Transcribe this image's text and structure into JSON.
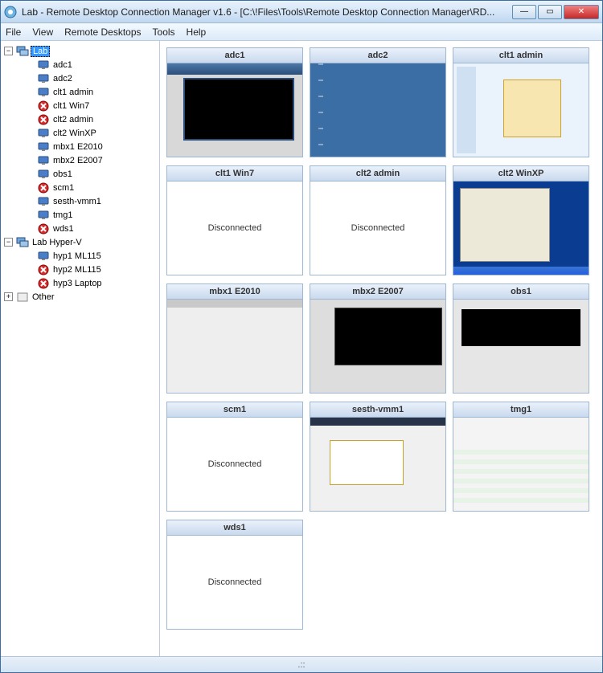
{
  "window": {
    "title": "Lab - Remote Desktop Connection Manager v1.6 - [C:\\!Files\\Tools\\Remote Desktop Connection Manager\\RD..."
  },
  "menu": {
    "file": "File",
    "view": "View",
    "remote": "Remote Desktops",
    "tools": "Tools",
    "help": "Help"
  },
  "tree": {
    "lab": {
      "label": "Lab",
      "expanded": true,
      "selected": true
    },
    "lab_items": [
      {
        "label": "adc1",
        "status": "ok"
      },
      {
        "label": "adc2",
        "status": "ok"
      },
      {
        "label": "clt1 admin",
        "status": "ok"
      },
      {
        "label": "clt1 Win7",
        "status": "err"
      },
      {
        "label": "clt2 admin",
        "status": "err"
      },
      {
        "label": "clt2 WinXP",
        "status": "ok"
      },
      {
        "label": "mbx1 E2010",
        "status": "ok"
      },
      {
        "label": "mbx2 E2007",
        "status": "ok"
      },
      {
        "label": "obs1",
        "status": "ok"
      },
      {
        "label": "scm1",
        "status": "err"
      },
      {
        "label": "sesth-vmm1",
        "status": "ok"
      },
      {
        "label": "tmg1",
        "status": "ok"
      },
      {
        "label": "wds1",
        "status": "err"
      }
    ],
    "hyperv": {
      "label": "Lab Hyper-V",
      "expanded": true
    },
    "hyperv_items": [
      {
        "label": "hyp1 ML115",
        "status": "ok"
      },
      {
        "label": "hyp2 ML115",
        "status": "err"
      },
      {
        "label": "hyp3 Laptop",
        "status": "err"
      }
    ],
    "other": {
      "label": "Other",
      "expanded": false
    }
  },
  "thumbnails": [
    {
      "title": "adc1",
      "state": "connected",
      "view": "adc1"
    },
    {
      "title": "adc2",
      "state": "connected",
      "view": "adc2"
    },
    {
      "title": "clt1 admin",
      "state": "connected",
      "view": "clt1admin"
    },
    {
      "title": "clt1 Win7",
      "state": "disconnected"
    },
    {
      "title": "clt2 admin",
      "state": "disconnected"
    },
    {
      "title": "clt2 WinXP",
      "state": "connected",
      "view": "clt2winxp"
    },
    {
      "title": "mbx1 E2010",
      "state": "connected",
      "view": "mbx1"
    },
    {
      "title": "mbx2 E2007",
      "state": "connected",
      "view": "mbx2"
    },
    {
      "title": "obs1",
      "state": "connected",
      "view": "obs1"
    },
    {
      "title": "scm1",
      "state": "disconnected"
    },
    {
      "title": "sesth-vmm1",
      "state": "connected",
      "view": "sesth"
    },
    {
      "title": "tmg1",
      "state": "connected",
      "view": "tmg1"
    },
    {
      "title": "wds1",
      "state": "disconnected"
    }
  ],
  "strings": {
    "disconnected": "Disconnected",
    "statusbar_grip": ".::"
  }
}
